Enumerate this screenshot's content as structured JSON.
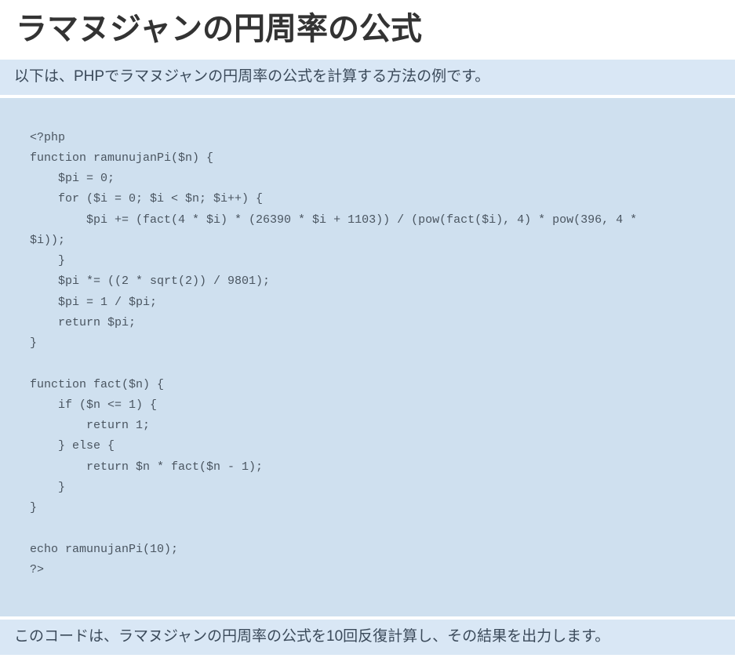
{
  "title": "ラマヌジャンの円周率の公式",
  "intro": "以下は、PHPでラマヌジャンの円周率の公式を計算する方法の例です。",
  "code": "<?php\nfunction ramunujanPi($n) {\n    $pi = 0;\n    for ($i = 0; $i < $n; $i++) {\n        $pi += (fact(4 * $i) * (26390 * $i + 1103)) / (pow(fact($i), 4) * pow(396, 4 * \n$i));\n    }\n    $pi *= ((2 * sqrt(2)) / 9801);\n    $pi = 1 / $pi;\n    return $pi;\n}\n\nfunction fact($n) {\n    if ($n <= 1) {\n        return 1;\n    } else {\n        return $n * fact($n - 1);\n    }\n}\n\necho ramunujanPi(10);\n?>",
  "outro": "このコードは、ラマヌジャンの円周率の公式を10回反復計算し、その結果を出力します。"
}
